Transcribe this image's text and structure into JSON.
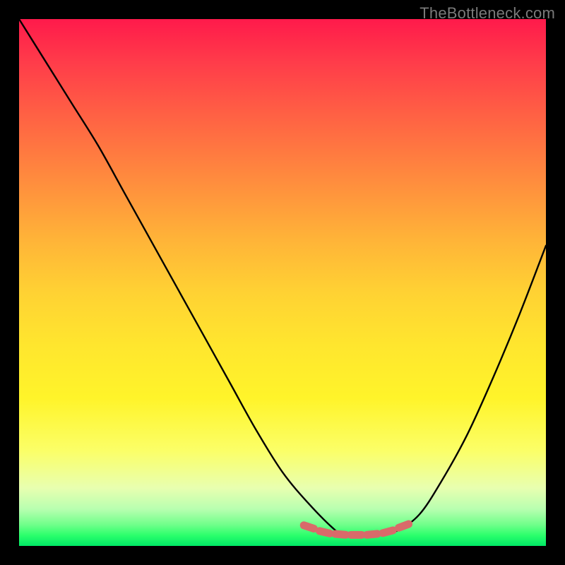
{
  "watermark": "TheBottleneck.com",
  "colors": {
    "page_bg": "#000000",
    "gradient_top": "#ff1a4b",
    "gradient_mid": "#ffe62e",
    "gradient_bottom": "#00e865",
    "curve_stroke": "#000000",
    "marker_fill": "#d96a6a"
  },
  "chart_data": {
    "type": "line",
    "title": "",
    "xlabel": "",
    "ylabel": "",
    "xlim": [
      0,
      100
    ],
    "ylim": [
      0,
      100
    ],
    "grid": false,
    "legend": false,
    "series": [
      {
        "name": "bottleneck-curve",
        "x": [
          0,
          5,
          10,
          15,
          20,
          25,
          30,
          35,
          40,
          45,
          50,
          55,
          60,
          62,
          65,
          68,
          72,
          76,
          80,
          85,
          90,
          95,
          100
        ],
        "y": [
          100,
          92,
          84,
          76,
          67,
          58,
          49,
          40,
          31,
          22,
          14,
          8,
          3,
          2,
          2,
          2,
          3,
          6,
          12,
          21,
          32,
          44,
          57
        ]
      }
    ],
    "markers": {
      "name": "bottom-dashes",
      "x": [
        55,
        58,
        61,
        64,
        67,
        70,
        73
      ],
      "y": [
        3.6,
        2.6,
        2.2,
        2.1,
        2.2,
        2.7,
        3.8
      ]
    }
  }
}
